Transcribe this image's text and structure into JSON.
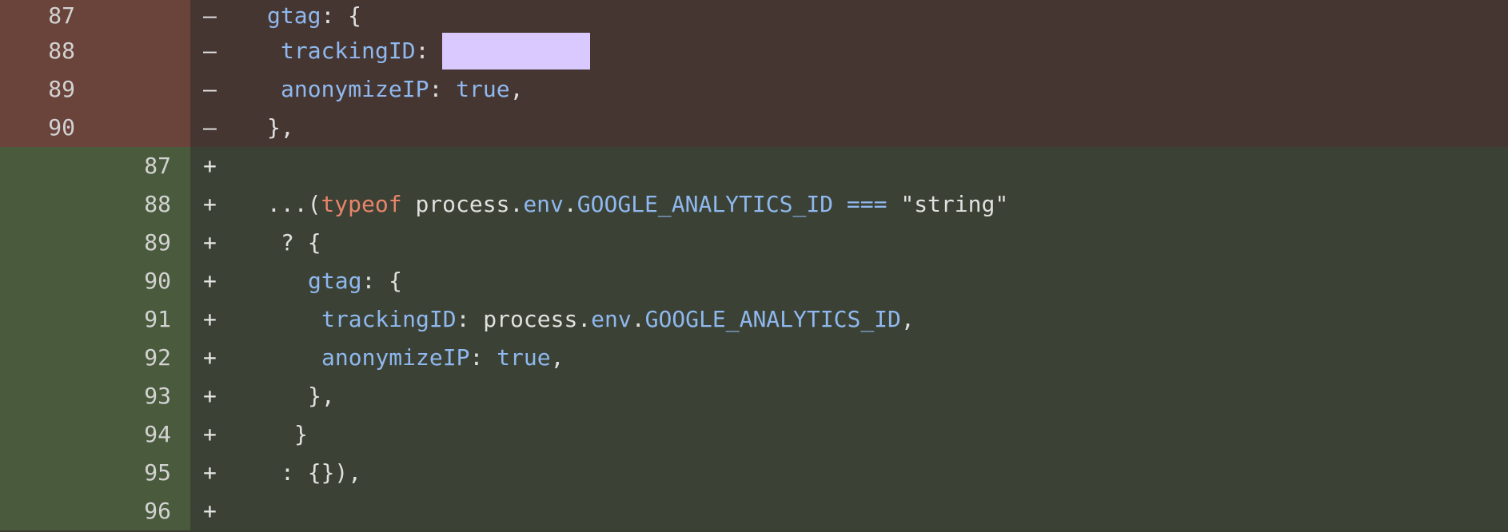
{
  "colors": {
    "deleted_bg": "#463632",
    "deleted_gutter": "#6a433a",
    "added_bg": "#3b4134",
    "added_gutter": "#4a5a3c",
    "keyword": "#e8856b",
    "property": "#8fb8ee",
    "plain": "#e0e0e0",
    "redaction": "#d9c9ff"
  },
  "lines": [
    {
      "type": "del",
      "old": "87",
      "new": "",
      "marker": "–",
      "indent": 2,
      "tokens": [
        [
          "prop",
          "gtag"
        ],
        [
          "plain",
          ": {"
        ]
      ]
    },
    {
      "type": "del",
      "old": "88",
      "new": "",
      "marker": "–",
      "indent": 3,
      "tokens": [
        [
          "prop",
          "trackingID"
        ],
        [
          "plain",
          ": "
        ],
        [
          "redact",
          "185"
        ]
      ]
    },
    {
      "type": "del",
      "old": "89",
      "new": "",
      "marker": "–",
      "indent": 3,
      "tokens": [
        [
          "prop",
          "anonymizeIP"
        ],
        [
          "plain",
          ": "
        ],
        [
          "prop",
          "true"
        ],
        [
          "plain",
          ","
        ]
      ]
    },
    {
      "type": "del",
      "old": "90",
      "new": "",
      "marker": "–",
      "indent": 2,
      "tokens": [
        [
          "plain",
          "},"
        ]
      ]
    },
    {
      "type": "add",
      "old": "",
      "new": "87",
      "marker": "+",
      "indent": 0,
      "tokens": []
    },
    {
      "type": "add",
      "old": "",
      "new": "88",
      "marker": "+",
      "indent": 2,
      "tokens": [
        [
          "plain",
          "...("
        ],
        [
          "kw",
          "typeof"
        ],
        [
          "plain",
          " process."
        ],
        [
          "prop",
          "env"
        ],
        [
          "plain",
          "."
        ],
        [
          "prop",
          "GOOGLE_ANALYTICS_ID"
        ],
        [
          "plain",
          " "
        ],
        [
          "prop",
          "==="
        ],
        [
          "plain",
          " \"string\""
        ]
      ]
    },
    {
      "type": "add",
      "old": "",
      "new": "89",
      "marker": "+",
      "indent": 3,
      "tokens": [
        [
          "plain",
          "? {"
        ]
      ]
    },
    {
      "type": "add",
      "old": "",
      "new": "90",
      "marker": "+",
      "indent": 5,
      "tokens": [
        [
          "prop",
          "gtag"
        ],
        [
          "plain",
          ": {"
        ]
      ]
    },
    {
      "type": "add",
      "old": "",
      "new": "91",
      "marker": "+",
      "indent": 6,
      "tokens": [
        [
          "prop",
          "trackingID"
        ],
        [
          "plain",
          ": process."
        ],
        [
          "prop",
          "env"
        ],
        [
          "plain",
          "."
        ],
        [
          "prop",
          "GOOGLE_ANALYTICS_ID"
        ],
        [
          "plain",
          ","
        ]
      ]
    },
    {
      "type": "add",
      "old": "",
      "new": "92",
      "marker": "+",
      "indent": 6,
      "tokens": [
        [
          "prop",
          "anonymizeIP"
        ],
        [
          "plain",
          ": "
        ],
        [
          "prop",
          "true"
        ],
        [
          "plain",
          ","
        ]
      ]
    },
    {
      "type": "add",
      "old": "",
      "new": "93",
      "marker": "+",
      "indent": 5,
      "tokens": [
        [
          "plain",
          "},"
        ]
      ]
    },
    {
      "type": "add",
      "old": "",
      "new": "94",
      "marker": "+",
      "indent": 4,
      "tokens": [
        [
          "plain",
          "}"
        ]
      ]
    },
    {
      "type": "add",
      "old": "",
      "new": "95",
      "marker": "+",
      "indent": 3,
      "tokens": [
        [
          "plain",
          ": {}),"
        ]
      ]
    },
    {
      "type": "add",
      "old": "",
      "new": "96",
      "marker": "+",
      "indent": 0,
      "tokens": []
    }
  ]
}
